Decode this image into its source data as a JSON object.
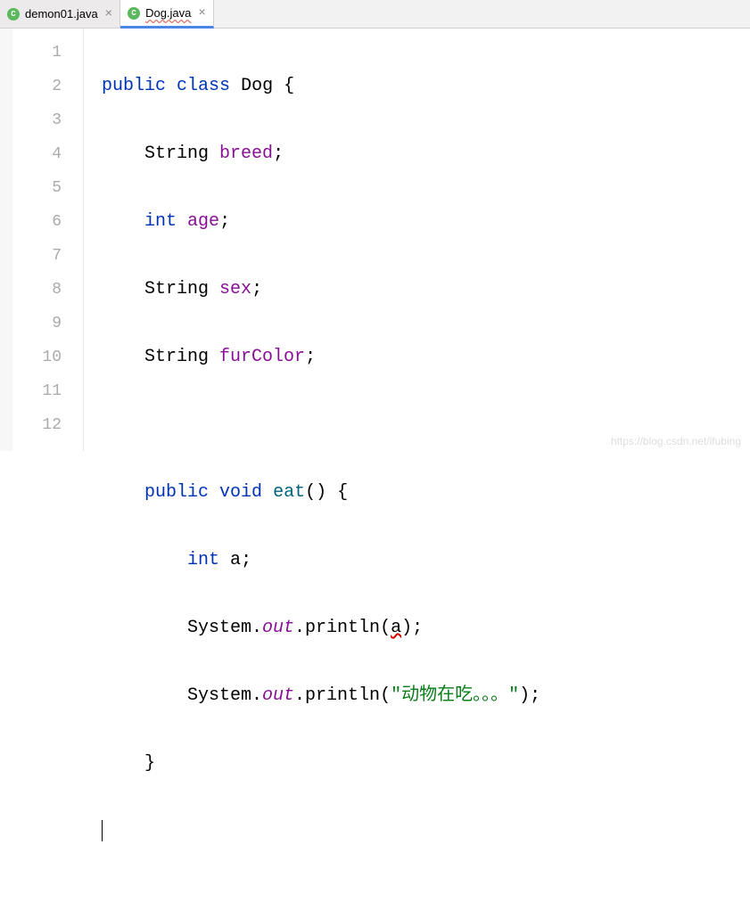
{
  "tabs": [
    {
      "label": "demon01.java",
      "active": false
    },
    {
      "label": "Dog.java",
      "active": true
    }
  ],
  "lineNumbers": [
    "1",
    "2",
    "3",
    "4",
    "5",
    "6",
    "7",
    "8",
    "9",
    "10",
    "11",
    "12"
  ],
  "code": {
    "l1_public": "public",
    "l1_class": "class",
    "l1_name": "Dog",
    "l1_brace": " {",
    "l2_type": "String",
    "l2_field": "breed",
    "l2_semi": ";",
    "l3_type": "int",
    "l3_field": "age",
    "l3_semi": ";",
    "l4_type": "String",
    "l4_field": "sex",
    "l4_semi": ";",
    "l5_type": "String",
    "l5_field": "furColor",
    "l5_semi": ";",
    "l7_public": "public",
    "l7_void": "void",
    "l7_method": "eat",
    "l7_rest": "() {",
    "l8_type": "int",
    "l8_var": "a",
    "l8_semi": ";",
    "l9_sys": "System.",
    "l9_out": "out",
    "l9_dot": ".println(",
    "l9_arg": "a",
    "l9_close": ");",
    "l10_sys": "System.",
    "l10_out": "out",
    "l10_dot": ".println(",
    "l10_str": "\"动物在吃。。。\"",
    "l10_close": ");",
    "l11_brace": "}"
  },
  "watermark": "https://blog.csdn.net/ifubing"
}
